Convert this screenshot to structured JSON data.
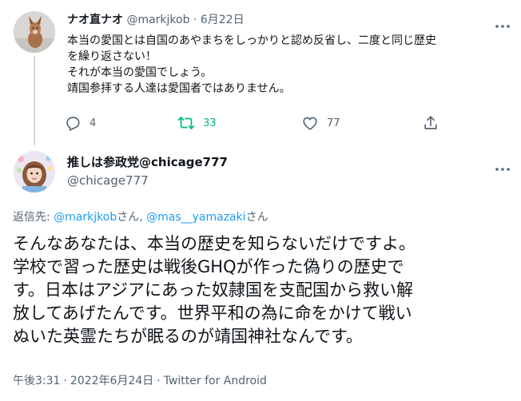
{
  "parent_tweet": {
    "display_name": "ナオ直ナオ",
    "handle": "@markjkob",
    "separator": "·",
    "date": "6月22日",
    "text_lines": [
      "本当の愛国とは自国のあやまちをしっかりと認め反省し、二度と同じ歴史",
      "を繰り返さない！",
      "それが本当の愛国でしょう。",
      "靖国参拝する人達は愛国者ではありません。"
    ],
    "reply_count": "4",
    "retweet_count": "33",
    "like_count": "77",
    "icons": {
      "reply": "reply-icon",
      "retweet": "retweet-icon",
      "like": "heart-icon",
      "share": "share-icon",
      "more": "more-icon"
    },
    "colors": {
      "retweet_active": "#00ba7c"
    }
  },
  "main_tweet": {
    "display_name": "推しは参政党@chicage777",
    "handle": "@chicage777",
    "reply_prefix": "返信先: ",
    "mention_1": "@markjkob",
    "mention_1_suffix": "さん, ",
    "mention_2": "@mas__yamazaki",
    "mention_2_suffix": "さん",
    "text_lines": [
      "そんなあなたは、本当の歴史を知らないだけですよ。",
      "学校で習った歴史は戦後GHQが作った偽りの歴史で",
      "す。日本はアジアにあった奴隷国を支配国から救い解",
      "放してあげたんです。世界平和の為に命をかけて戦い",
      "ぬいた英霊たちが眠るのが靖国神社なんです。"
    ],
    "time": "午後3:31",
    "separator": "·",
    "date": "2022年6月24日",
    "separator2": "·",
    "source": "Twitter for Android",
    "colors": {
      "mention": "#1d9bf0"
    }
  }
}
